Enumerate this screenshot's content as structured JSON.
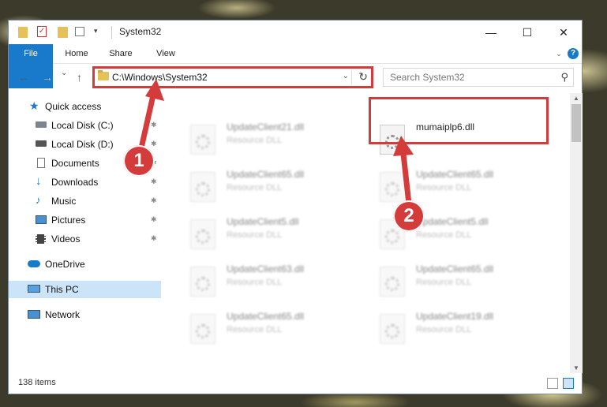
{
  "window": {
    "title": "System32",
    "controls": {
      "minimize": "—",
      "maximize": "☐",
      "close": "✕"
    }
  },
  "ribbon": {
    "tabs": [
      {
        "label": "File"
      },
      {
        "label": "Home"
      },
      {
        "label": "Share"
      },
      {
        "label": "View"
      }
    ],
    "help": "?"
  },
  "navbar": {
    "back": "←",
    "forward": "→",
    "recent": "⌄",
    "up": "↑",
    "address": "C:\\Windows\\System32",
    "dropdown": "⌄",
    "refresh": "↻",
    "search_placeholder": "Search System32",
    "search_icon": "⚲"
  },
  "sidebar": {
    "items": [
      {
        "label": "Quick access",
        "icon": "star-icon",
        "color": "#1979ca"
      },
      {
        "label": "Local Disk (C:)",
        "icon": "drive-icon"
      },
      {
        "label": "Local Disk (D:)",
        "icon": "drive-icon"
      },
      {
        "label": "Documents",
        "icon": "document-icon"
      },
      {
        "label": "Downloads",
        "icon": "download-icon"
      },
      {
        "label": "Music",
        "icon": "music-icon"
      },
      {
        "label": "Pictures",
        "icon": "pictures-icon"
      },
      {
        "label": "Videos",
        "icon": "videos-icon"
      },
      {
        "label": "OneDrive",
        "icon": "cloud-icon"
      },
      {
        "label": "This PC",
        "icon": "computer-icon"
      },
      {
        "label": "Network",
        "icon": "network-icon"
      }
    ]
  },
  "files": [
    {
      "name": "UpdateClient21.dll",
      "type": "Resource DLL"
    },
    {
      "name": "mumaiplp6.dll",
      "type": ""
    },
    {
      "name": "UpdateClient65.dll",
      "type": "Resource DLL"
    },
    {
      "name": "UpdateClient65.dll",
      "type": "Resource DLL"
    },
    {
      "name": "UpdateClient5.dll",
      "type": "Resource DLL"
    },
    {
      "name": "UpdateClient5.dll",
      "type": "Resource DLL"
    },
    {
      "name": "UpdateClient63.dll",
      "type": "Resource DLL"
    },
    {
      "name": "UpdateClient65.dll",
      "type": "Resource DLL"
    },
    {
      "name": "UpdateClient65.dll",
      "type": "Resource DLL"
    },
    {
      "name": "UpdateClient19.dll",
      "type": "Resource DLL"
    }
  ],
  "status": {
    "items_count": "138 items"
  },
  "annotations": {
    "step1": "1",
    "step2": "2",
    "color": "#d43b3b"
  },
  "colors": {
    "accent": "#1979ca",
    "selection": "#cce4f7"
  }
}
